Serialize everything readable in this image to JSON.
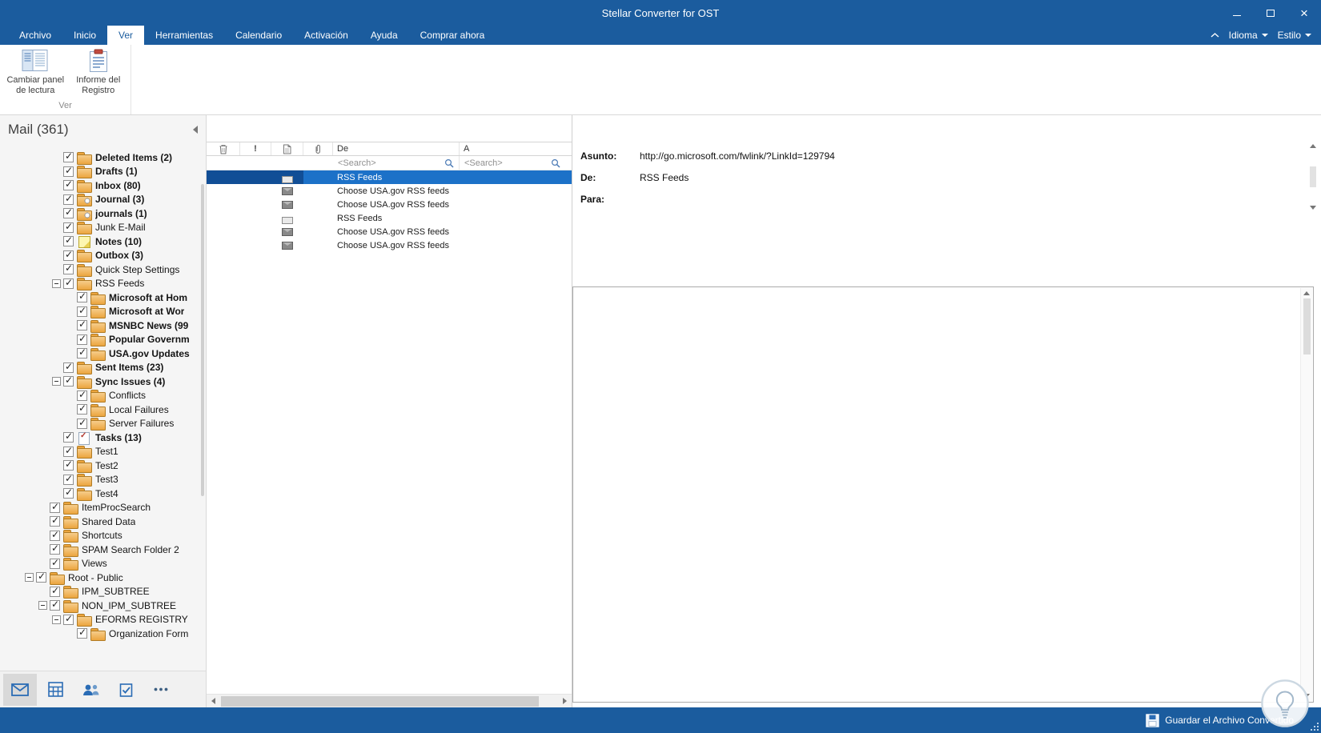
{
  "window": {
    "title": "Stellar Converter for OST",
    "controls": [
      {
        "name": "minimize"
      },
      {
        "name": "maximize"
      },
      {
        "name": "close"
      }
    ]
  },
  "menu": {
    "tabs": [
      {
        "label": "Archivo",
        "active": false
      },
      {
        "label": "Inicio",
        "active": false
      },
      {
        "label": "Ver",
        "active": true
      },
      {
        "label": "Herramientas",
        "active": false
      },
      {
        "label": "Calendario",
        "active": false
      },
      {
        "label": "Activación",
        "active": false
      },
      {
        "label": "Ayuda",
        "active": false
      },
      {
        "label": "Comprar ahora",
        "active": false
      }
    ],
    "right_dropdowns": [
      {
        "label": "Idioma"
      },
      {
        "label": "Estilo"
      }
    ]
  },
  "ribbon": {
    "group_label": "Ver",
    "buttons": [
      {
        "label": "Cambiar panel de lectura",
        "icon": "reading-pane-icon"
      },
      {
        "label": "Informe del Registro",
        "icon": "log-report-icon"
      }
    ]
  },
  "sidebar": {
    "header": "Mail (361)",
    "tree": [
      {
        "label": "Deleted Items (2)",
        "level": 2,
        "bold": true,
        "icon": "folder-icon"
      },
      {
        "label": "Drafts (1)",
        "level": 2,
        "bold": true,
        "icon": "folder-icon"
      },
      {
        "label": "Inbox (80)",
        "level": 2,
        "bold": true,
        "icon": "folder-icon"
      },
      {
        "label": "Journal (3)",
        "level": 2,
        "bold": true,
        "icon": "journal-folder-icon"
      },
      {
        "label": "journals (1)",
        "level": 2,
        "bold": true,
        "icon": "journal-folder-icon"
      },
      {
        "label": "Junk E-Mail",
        "level": 2,
        "bold": false,
        "icon": "folder-icon"
      },
      {
        "label": "Notes (10)",
        "level": 2,
        "bold": true,
        "icon": "note-icon"
      },
      {
        "label": "Outbox (3)",
        "level": 2,
        "bold": true,
        "icon": "folder-icon"
      },
      {
        "label": "Quick Step Settings",
        "level": 2,
        "bold": false,
        "icon": "folder-icon"
      },
      {
        "label": "RSS Feeds",
        "level": 2,
        "bold": false,
        "icon": "folder-icon",
        "expander": true
      },
      {
        "label": "Microsoft at Hom",
        "level": 3,
        "bold": true,
        "icon": "folder-icon"
      },
      {
        "label": "Microsoft at Wor",
        "level": 3,
        "bold": true,
        "icon": "folder-icon"
      },
      {
        "label": "MSNBC News (99",
        "level": 3,
        "bold": true,
        "icon": "folder-icon"
      },
      {
        "label": "Popular Governm",
        "level": 3,
        "bold": true,
        "icon": "folder-icon"
      },
      {
        "label": "USA.gov Updates",
        "level": 3,
        "bold": true,
        "icon": "folder-icon"
      },
      {
        "label": "Sent Items (23)",
        "level": 2,
        "bold": true,
        "icon": "folder-icon"
      },
      {
        "label": "Sync Issues (4)",
        "level": 2,
        "bold": true,
        "icon": "folder-icon",
        "expander": true
      },
      {
        "label": "Conflicts",
        "level": 3,
        "bold": false,
        "icon": "folder-icon"
      },
      {
        "label": "Local Failures",
        "level": 3,
        "bold": false,
        "icon": "folder-icon"
      },
      {
        "label": "Server Failures",
        "level": 3,
        "bold": false,
        "icon": "folder-icon"
      },
      {
        "label": "Tasks (13)",
        "level": 2,
        "bold": true,
        "icon": "task-folder-icon"
      },
      {
        "label": "Test1",
        "level": 2,
        "bold": false,
        "icon": "folder-icon"
      },
      {
        "label": "Test2",
        "level": 2,
        "bold": false,
        "icon": "folder-icon"
      },
      {
        "label": "Test3",
        "level": 2,
        "bold": false,
        "icon": "folder-icon"
      },
      {
        "label": "Test4",
        "level": 2,
        "bold": false,
        "icon": "folder-icon"
      },
      {
        "label": "ItemProcSearch",
        "level": 1,
        "bold": false,
        "icon": "folder-icon"
      },
      {
        "label": "Shared Data",
        "level": 1,
        "bold": false,
        "icon": "folder-icon"
      },
      {
        "label": "Shortcuts",
        "level": 1,
        "bold": false,
        "icon": "folder-icon"
      },
      {
        "label": "SPAM Search Folder 2",
        "level": 1,
        "bold": false,
        "icon": "folder-icon"
      },
      {
        "label": "Views",
        "level": 1,
        "bold": false,
        "icon": "folder-icon"
      },
      {
        "label": "Root - Public",
        "level": 0,
        "bold": false,
        "icon": "folder-icon",
        "expander": true
      },
      {
        "label": "IPM_SUBTREE",
        "level": 1,
        "bold": false,
        "icon": "folder-icon"
      },
      {
        "label": "NON_IPM_SUBTREE",
        "level": 1,
        "bold": false,
        "icon": "folder-icon",
        "expander": true
      },
      {
        "label": "EFORMS REGISTRY",
        "level": 2,
        "bold": false,
        "icon": "folder-icon",
        "expander": true
      },
      {
        "label": "Organization Form",
        "level": 3,
        "bold": false,
        "icon": "folder-icon"
      }
    ],
    "footer": [
      {
        "icon": "mail-icon",
        "active": true
      },
      {
        "icon": "calendar-icon",
        "active": false
      },
      {
        "icon": "contacts-icon",
        "active": false
      },
      {
        "icon": "tasks-icon",
        "active": false
      },
      {
        "icon": "more-icon",
        "active": false
      }
    ]
  },
  "message_list": {
    "columns": [
      {
        "icon": "trash-icon"
      },
      {
        "icon": "importance-icon",
        "glyph": "!"
      },
      {
        "icon": "document-icon"
      },
      {
        "icon": "attachment-icon"
      },
      {
        "label": "De"
      },
      {
        "label": "A"
      }
    ],
    "search_placeholder": "<Search>",
    "rows": [
      {
        "from": "RSS Feeds",
        "to": "",
        "icon": "mail-open-icon",
        "selected": true
      },
      {
        "from": "Choose USA.gov RSS feeds",
        "to": "",
        "icon": "mail-closed-icon",
        "selected": false
      },
      {
        "from": "Choose USA.gov RSS feeds",
        "to": "",
        "icon": "mail-closed-icon",
        "selected": false
      },
      {
        "from": "RSS Feeds",
        "to": "",
        "icon": "mail-open-icon",
        "selected": false
      },
      {
        "from": "Choose USA.gov RSS feeds",
        "to": "",
        "icon": "mail-closed-icon",
        "selected": false
      },
      {
        "from": "Choose USA.gov RSS feeds",
        "to": "",
        "icon": "mail-closed-icon",
        "selected": false
      }
    ]
  },
  "preview": {
    "fields": [
      {
        "label": "Asunto:",
        "value": "http://go.microsoft.com/fwlink/?LinkId=129794"
      },
      {
        "label": "De:",
        "value": "RSS Feeds"
      },
      {
        "label": "Para:",
        "value": ""
      }
    ]
  },
  "statusbar": {
    "save_label": "Guardar el Archivo Convertido",
    "save_icon": "save-icon"
  },
  "colors": {
    "titlebar_blue": "#1b5c9e",
    "selection_blue": "#1c71c8",
    "selection_blue_dark": "#114e96",
    "folder_orange": "#eca53e",
    "icon_blue": "#2a6cb5"
  }
}
